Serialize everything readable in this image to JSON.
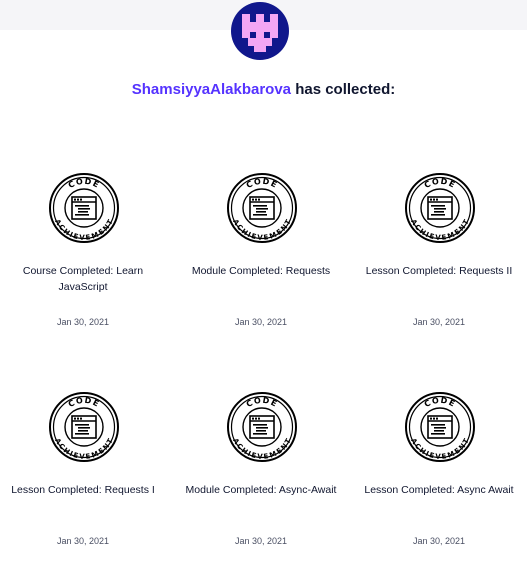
{
  "header": {
    "username": "ShamsiyyaAlakbarova",
    "collected_text": " has collected:"
  },
  "colors": {
    "avatar_bg": "#10178c",
    "avatar_figure": "#f4a6f4",
    "username": "#5533ff"
  },
  "badges": [
    {
      "icon": "code-achievement-badge-icon",
      "ring_top": "CODE",
      "ring_bottom": "ACHIEVEMENT",
      "title": "Course Completed: Learn JavaScript",
      "date": "Jan 30, 2021"
    },
    {
      "icon": "code-achievement-badge-icon",
      "ring_top": "CODE",
      "ring_bottom": "ACHIEVEMENT",
      "title": "Module Completed: Requests",
      "date": "Jan 30, 2021"
    },
    {
      "icon": "code-achievement-badge-icon",
      "ring_top": "CODE",
      "ring_bottom": "ACHIEVEMENT",
      "title": "Lesson Completed: Requests II",
      "date": "Jan 30, 2021"
    },
    {
      "icon": "code-achievement-badge-icon",
      "ring_top": "CODE",
      "ring_bottom": "ACHIEVEMENT",
      "title": "Lesson Completed: Requests I",
      "date": "Jan 30, 2021"
    },
    {
      "icon": "code-achievement-badge-icon",
      "ring_top": "CODE",
      "ring_bottom": "ACHIEVEMENT",
      "title": "Module Completed: Async-Await",
      "date": "Jan 30, 2021"
    },
    {
      "icon": "code-achievement-badge-icon",
      "ring_top": "CODE",
      "ring_bottom": "ACHIEVEMENT",
      "title": "Lesson Completed: Async Await",
      "date": "Jan 30, 2021"
    }
  ]
}
